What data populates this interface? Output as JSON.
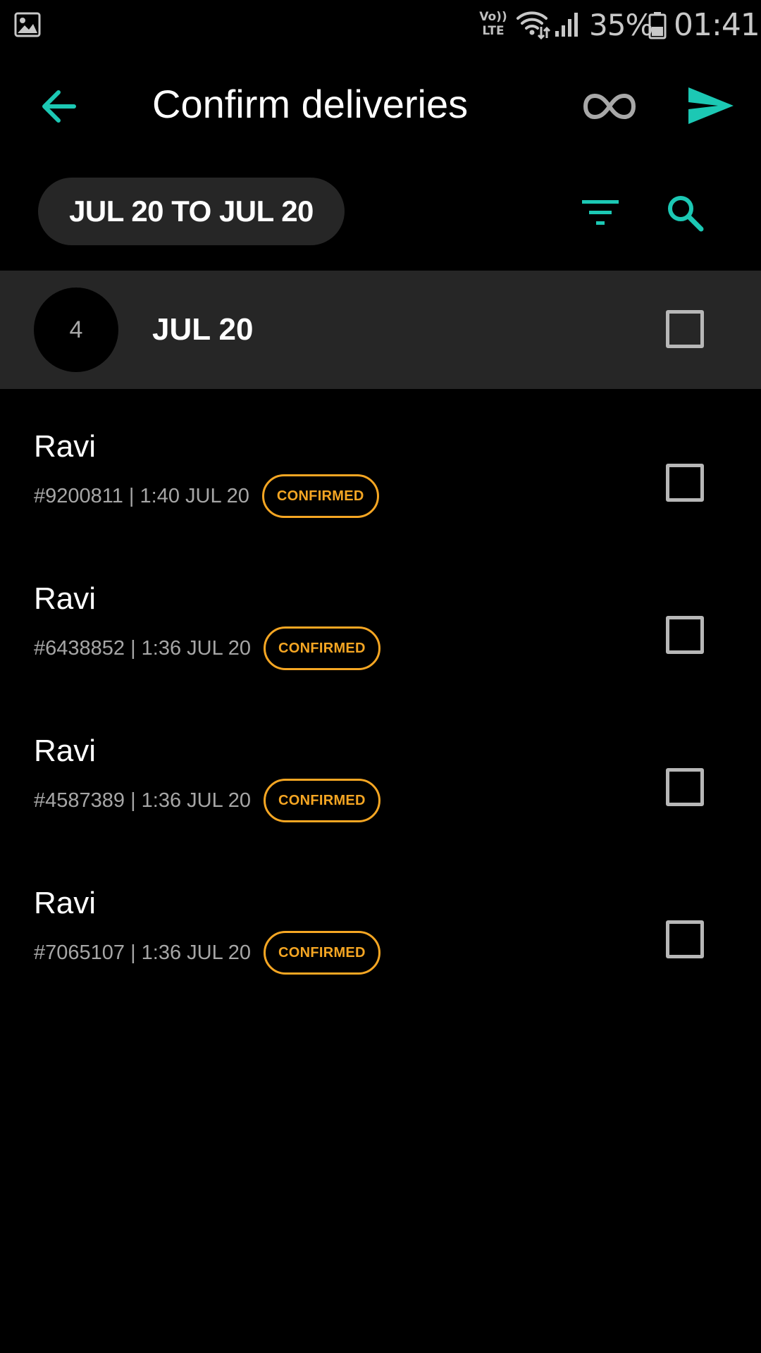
{
  "status_bar": {
    "left_icon": "gallery-image-icon",
    "volte_line1": "Vo))",
    "volte_line2": "LTE",
    "wifi_icon": "wifi-icon",
    "signal_icon": "signal-icon",
    "battery_percent": "35%",
    "battery_icon": "battery-icon",
    "time": "01:41"
  },
  "toolbar": {
    "title": "Confirm deliveries",
    "back_icon": "arrow-left-icon",
    "loop_icon": "infinity-icon",
    "send_icon": "send-icon"
  },
  "filters": {
    "date_range": "JUL 20 TO JUL 20",
    "filter_icon": "filter-icon",
    "search_icon": "search-icon"
  },
  "group": {
    "count": "4",
    "date": "JUL 20",
    "checked": false
  },
  "deliveries": [
    {
      "name": "Ravi",
      "sub": "#9200811 | 1:40 JUL 20",
      "status": "CONFIRMED",
      "checked": false
    },
    {
      "name": "Ravi",
      "sub": "#6438852 | 1:36 JUL 20",
      "status": "CONFIRMED",
      "checked": false
    },
    {
      "name": "Ravi",
      "sub": "#4587389 | 1:36 JUL 20",
      "status": "CONFIRMED",
      "checked": false
    },
    {
      "name": "Ravi",
      "sub": "#7065107 | 1:36 JUL 20",
      "status": "CONFIRMED",
      "checked": false
    }
  ],
  "colors": {
    "accent": "#1cc8b4",
    "status_confirmed": "#f5a623",
    "background": "#000000",
    "surface": "#262626",
    "muted_icon": "#a8a8a8"
  }
}
